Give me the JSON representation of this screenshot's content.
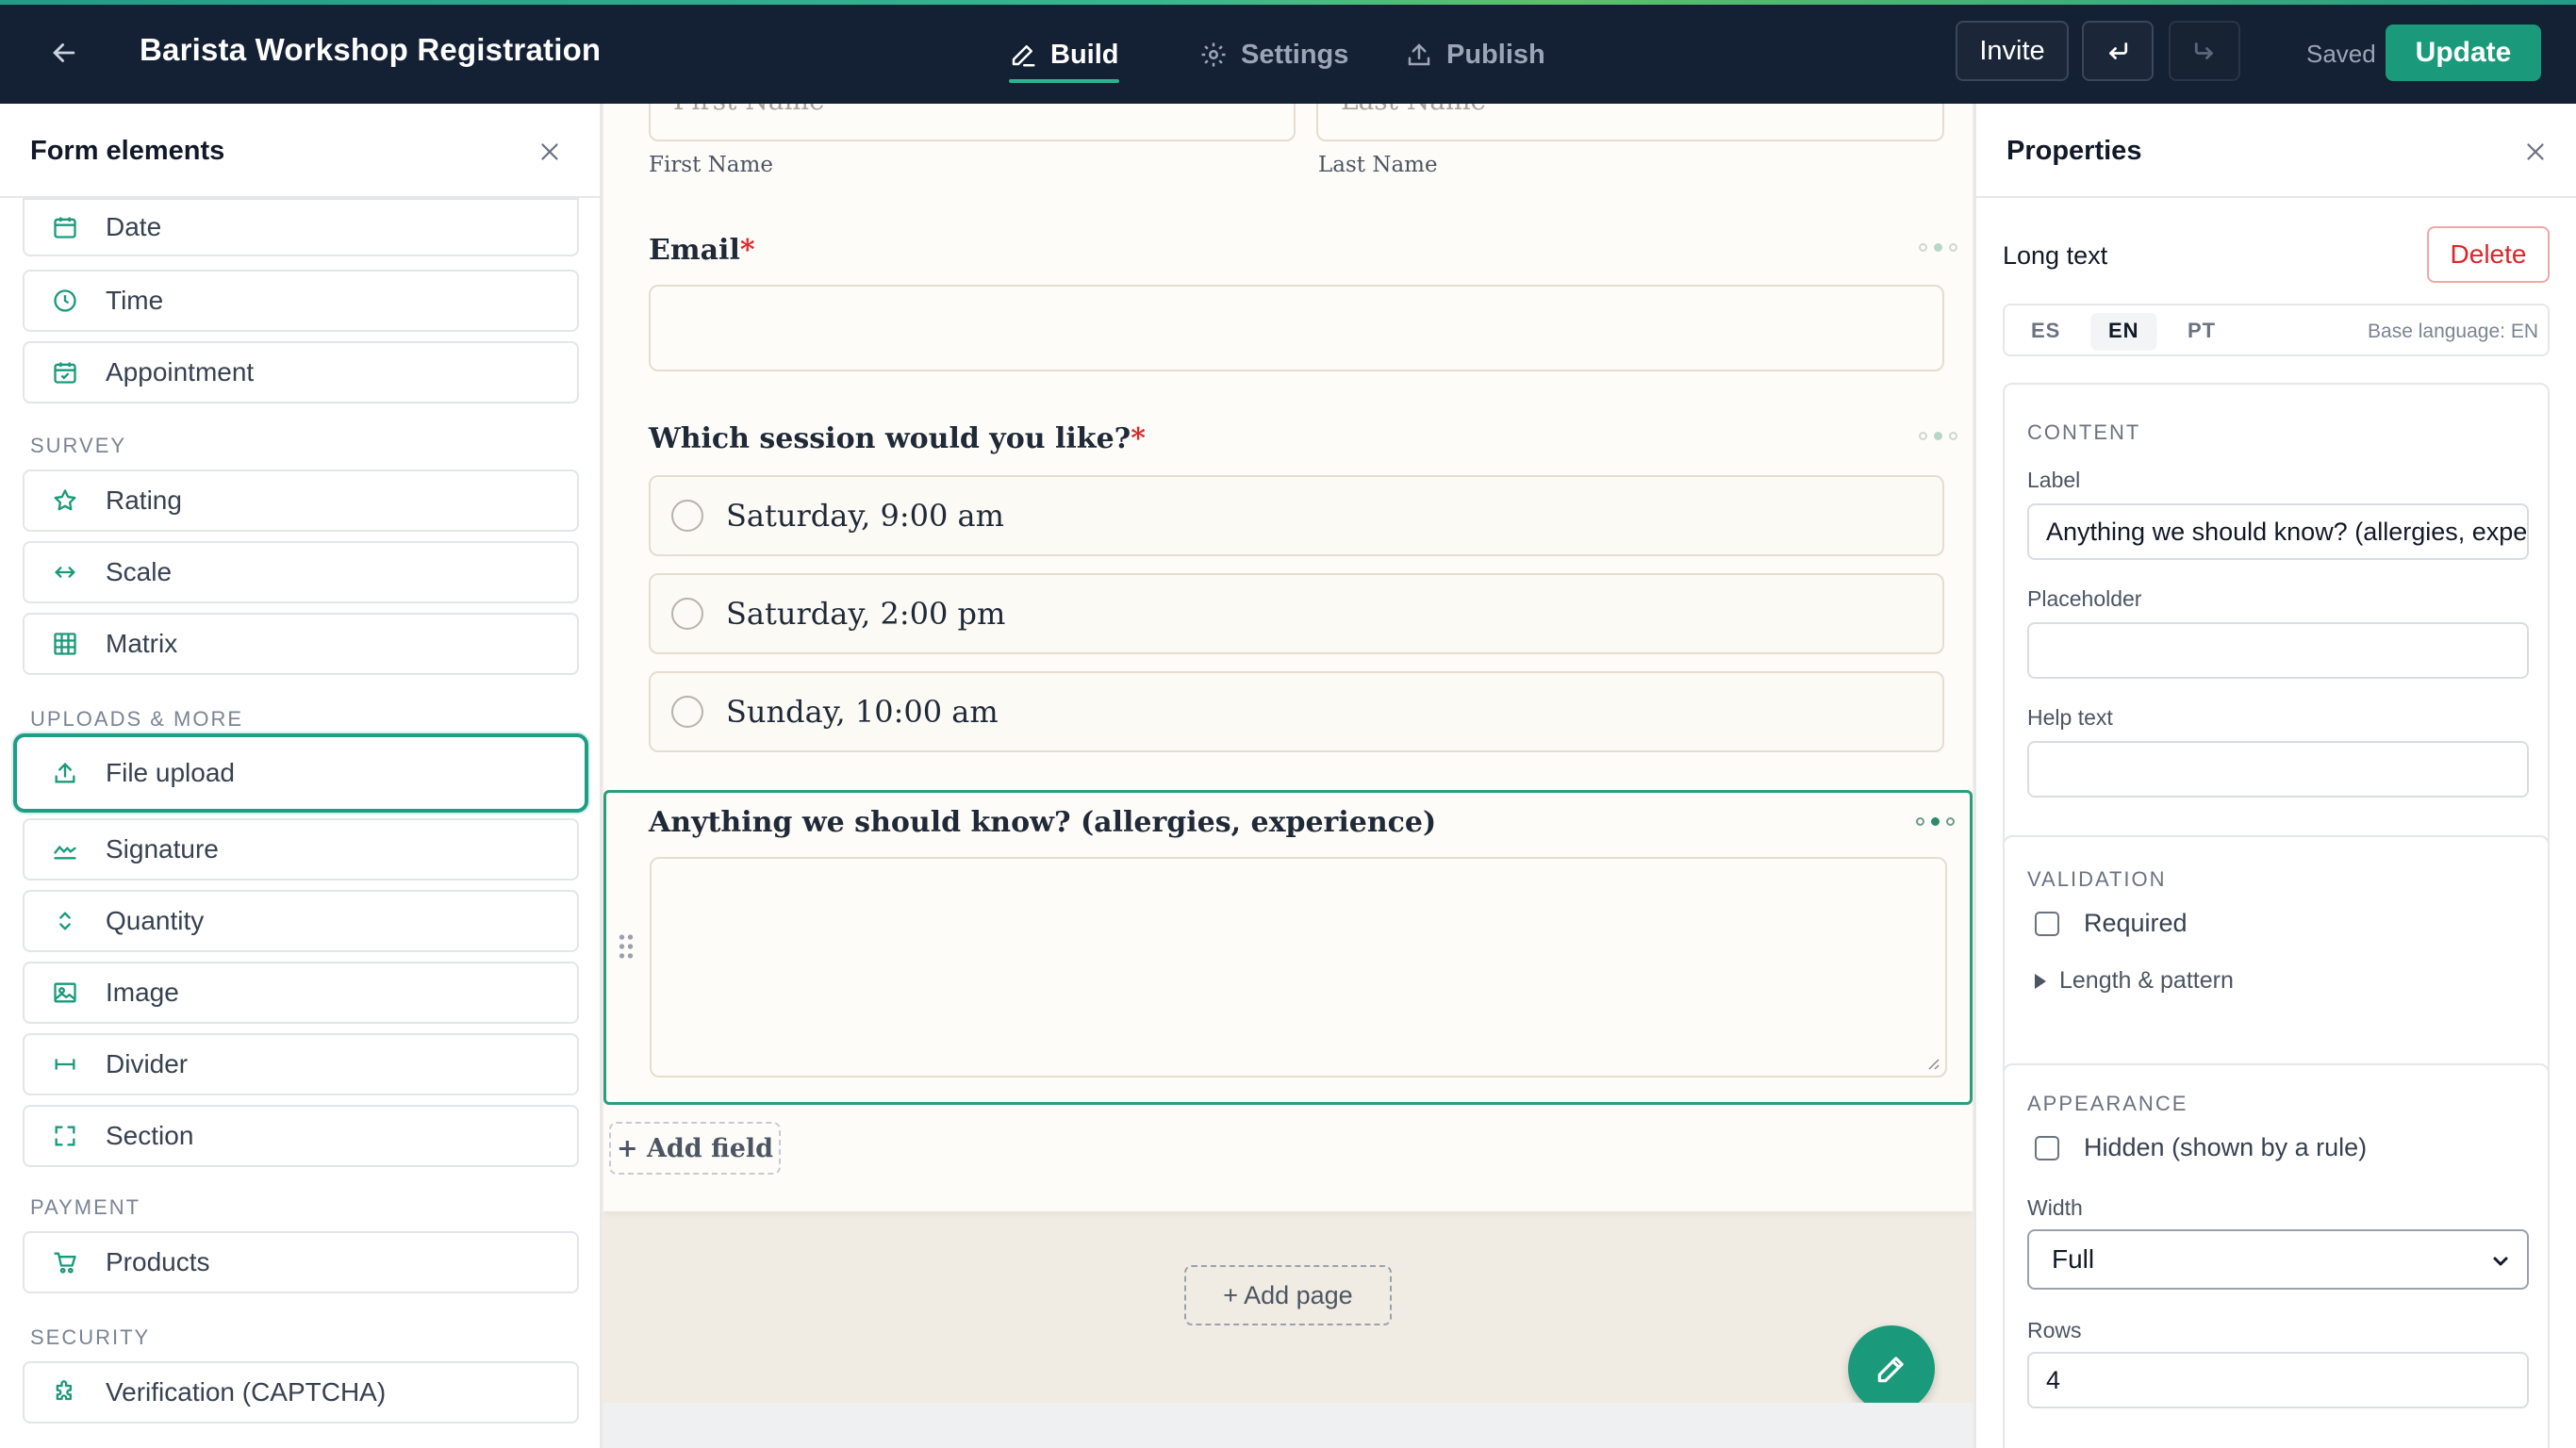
{
  "header": {
    "title": "Barista Workshop Registration",
    "tabs": [
      {
        "label": "Build",
        "icon": "pencil-icon",
        "active": true
      },
      {
        "label": "Settings",
        "icon": "gear-icon",
        "active": false
      },
      {
        "label": "Publish",
        "icon": "upload-icon",
        "active": false
      }
    ],
    "invite_label": "Invite",
    "saved_label": "Saved",
    "update_label": "Update"
  },
  "left_panel": {
    "title": "Form elements",
    "items_top": [
      {
        "label": "Date",
        "icon": "calendar-icon"
      },
      {
        "label": "Time",
        "icon": "clock-icon"
      },
      {
        "label": "Appointment",
        "icon": "calendar-check-icon"
      }
    ],
    "survey": {
      "label": "SURVEY",
      "items": [
        {
          "label": "Rating",
          "icon": "star-icon"
        },
        {
          "label": "Scale",
          "icon": "arrows-horizontal-icon"
        },
        {
          "label": "Matrix",
          "icon": "grid-icon"
        }
      ]
    },
    "uploads": {
      "label": "UPLOADS & MORE",
      "items": [
        {
          "label": "File upload",
          "icon": "upload-icon",
          "highlighted": true
        },
        {
          "label": "Signature",
          "icon": "signature-icon"
        },
        {
          "label": "Quantity",
          "icon": "up-down-chevron-icon"
        },
        {
          "label": "Image",
          "icon": "image-icon"
        },
        {
          "label": "Divider",
          "icon": "divider-icon"
        },
        {
          "label": "Section",
          "icon": "section-frame-icon"
        }
      ]
    },
    "payment": {
      "label": "PAYMENT",
      "items": [
        {
          "label": "Products",
          "icon": "cart-icon"
        }
      ]
    },
    "security": {
      "label": "SECURITY",
      "items": [
        {
          "label": "Verification (CAPTCHA)",
          "icon": "puzzle-icon"
        }
      ]
    }
  },
  "canvas": {
    "name_placeholders": [
      "First Name",
      "Last Name"
    ],
    "name_sublabels": [
      "First Name",
      "Last Name"
    ],
    "email_label": "Email",
    "required_mark": "*",
    "session_label": "Which session would you like?",
    "session_options": [
      "Saturday, 9:00 am",
      "Saturday, 2:00 pm",
      "Sunday, 10:00 am"
    ],
    "selected_field_label": "Anything we should know? (allergies, experience)",
    "add_field_label": "+ Add field",
    "add_page_label": "+ Add page"
  },
  "properties": {
    "title": "Properties",
    "field_type": "Long text",
    "delete_label": "Delete",
    "languages": [
      "ES",
      "EN",
      "PT"
    ],
    "active_language": "EN",
    "base_language": "Base language: EN",
    "content": {
      "title": "CONTENT",
      "label_caption": "Label",
      "label_value": "Anything we should know? (allergies, experience)",
      "placeholder_caption": "Placeholder",
      "placeholder_value": "",
      "help_caption": "Help text",
      "help_value": ""
    },
    "validation": {
      "title": "VALIDATION",
      "required_label": "Required",
      "required_checked": false,
      "length_label": "Length & pattern"
    },
    "appearance": {
      "title": "APPEARANCE",
      "hidden_label": "Hidden (shown by a rule)",
      "hidden_checked": false,
      "width_caption": "Width",
      "width_value": "Full",
      "rows_caption": "Rows",
      "rows_value": "4"
    }
  },
  "colors": {
    "topbar": "#142033",
    "accent": "#1a9a7a",
    "danger": "#dc2626",
    "canvas_bg": "#f1ece3",
    "page_bg": "#fefcf8"
  }
}
